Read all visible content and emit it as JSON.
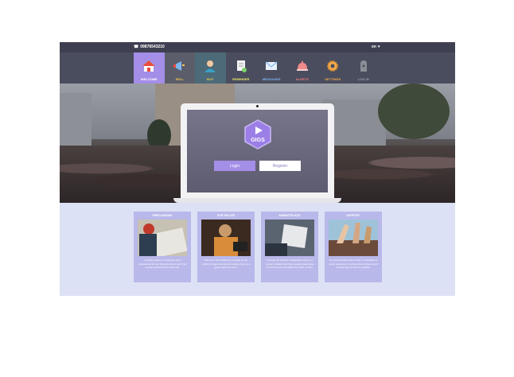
{
  "topbar": {
    "phone": "09876543210",
    "language": "en"
  },
  "nav": [
    {
      "label": "WELCOME",
      "icon": "home-icon",
      "color": "#ffffff"
    },
    {
      "label": "SELL",
      "icon": "megaphone-icon",
      "color": "#f2c94c"
    },
    {
      "label": "BUY",
      "icon": "buyer-icon",
      "color": "#f2c94c"
    },
    {
      "label": "REMINDER",
      "icon": "reminder-icon",
      "color": "#e8e46a"
    },
    {
      "label": "MESSAGES",
      "icon": "envelope-icon",
      "color": "#7fb6f0"
    },
    {
      "label": "ALERTS",
      "icon": "bell-icon",
      "color": "#f07f7f"
    },
    {
      "label": "SETTINGS",
      "icon": "gear-icon",
      "color": "#f2a94c"
    },
    {
      "label": "LOG IN",
      "icon": "login-icon",
      "color": "#9aa0a8"
    }
  ],
  "hero": {
    "logo_text": "GIGS",
    "login_label": "Login",
    "register_label": "Register"
  },
  "cards": [
    {
      "title": "FREELANCING",
      "text": "A creative place to showcase all of professional art and hire jobs where each find a great professional to work with."
    },
    {
      "title": "FOR SELLER",
      "text": "With over 100 freelancers working on the number of gigs and services selling, there is a great reason to come."
    },
    {
      "title": "MARKETPLACE",
      "text": "A simple but effective marketplace built on a modern platform and fast, equally great value for both buyers and sellers and earn, in time."
    },
    {
      "title": "SUPPORT",
      "text": "Our professional support team is dedicated to assist customers in solving their problems and provide help as fast as possible."
    }
  ],
  "colors": {
    "accent": "#a48ee8",
    "topbar": "#3e4052",
    "nav": "#4a4d5e",
    "content_bg": "#dde1f5",
    "card_bg": "#b8b8ea"
  }
}
